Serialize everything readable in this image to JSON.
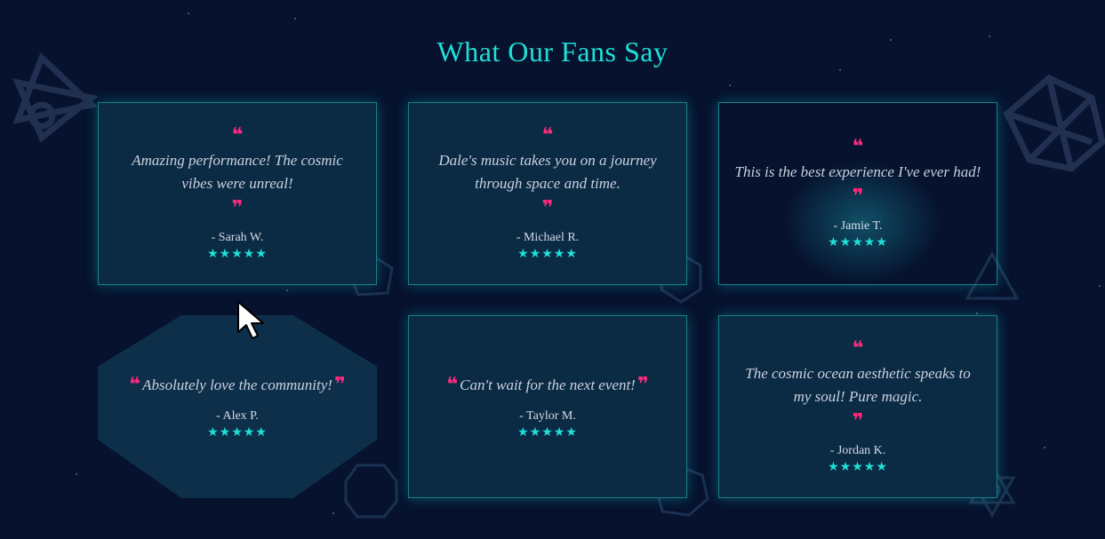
{
  "section": {
    "title": "What Our Fans Say"
  },
  "testimonials": [
    {
      "text": "Amazing performance! The cosmic vibes were unreal!",
      "author": "- Sarah W.",
      "stars": "★★★★★"
    },
    {
      "text": "Dale's music takes you on a journey through space and time.",
      "author": "- Michael R.",
      "stars": "★★★★★"
    },
    {
      "text": "This is the best experience I've ever had!",
      "author": "- Jamie T.",
      "stars": "★★★★★"
    },
    {
      "text": "Absolutely love the community!",
      "author": "- Alex P.",
      "stars": "★★★★★"
    },
    {
      "text": "Can't wait for the next event!",
      "author": "- Taylor M.",
      "stars": "★★★★★"
    },
    {
      "text": "The cosmic ocean aesthetic speaks to my soul! Pure magic.",
      "author": "- Jordan K.",
      "stars": "★★★★★"
    }
  ],
  "icons": {
    "open_quote": "❝",
    "close_quote": "❞",
    "cursor": "arrow-cursor-icon"
  },
  "colors": {
    "background": "#06122e",
    "accent": "#1fe0d8",
    "quote": "#ff2a7d",
    "card": "#0b2a44"
  }
}
